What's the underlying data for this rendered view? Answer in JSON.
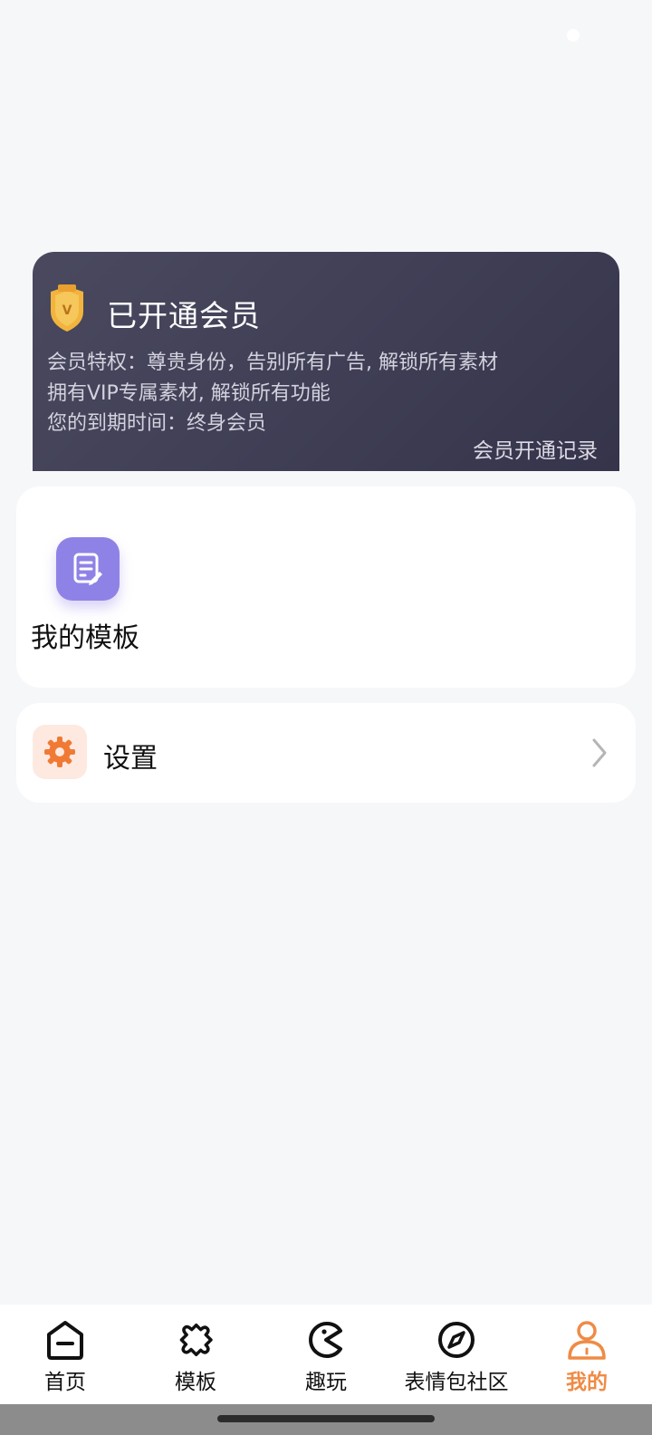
{
  "vip": {
    "title": "已开通会员",
    "privilege": "会员特权：尊贵身份，告别所有广告, 解锁所有素材",
    "extra": "拥有VIP专属素材, 解锁所有功能",
    "expiry": "您的到期时间：终身会员",
    "records_link": "会员开通记录"
  },
  "templates": {
    "label": "我的模板",
    "icon": "document-edit-icon"
  },
  "settings": {
    "label": "设置",
    "icon": "gear-icon"
  },
  "nav": {
    "home": "首页",
    "templates": "模板",
    "fun": "趣玩",
    "sticker_community": "表情包社区",
    "mine": "我的",
    "active": "mine"
  },
  "colors": {
    "accent": "#ef8b45",
    "vip_card": "#413f56",
    "template_icon": "#8f82e6",
    "settings_icon": "#f07a35"
  }
}
